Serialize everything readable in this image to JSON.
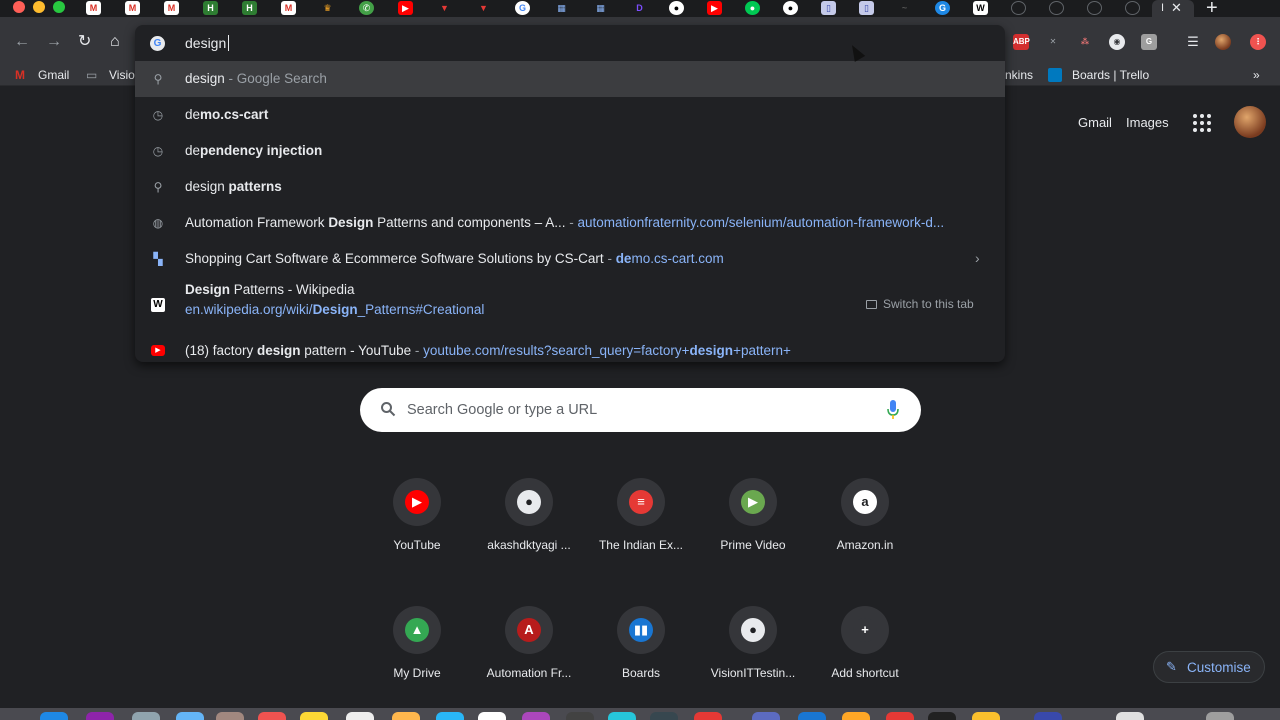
{
  "omnibox": {
    "query": "design",
    "suggestions": [
      {
        "icon": "search-icon",
        "plain_pre": "",
        "bold": "",
        "plain_post": "design",
        "url": "",
        "url_bold": "",
        "url_post": "",
        "extra": " - Google Search"
      },
      {
        "icon": "history-icon",
        "plain_pre": "de",
        "bold": "mo.cs-cart",
        "plain_post": "",
        "extra": ""
      },
      {
        "icon": "history-icon",
        "plain_pre": "de",
        "bold": "pendency injection",
        "plain_post": "",
        "extra": ""
      },
      {
        "icon": "search-icon",
        "plain_pre": "design ",
        "bold": "patterns",
        "plain_post": "",
        "extra": ""
      },
      {
        "icon": "globe-icon",
        "plain_pre": "Automation Framework ",
        "bold": "Design",
        "plain_post": " Patterns and components – A...",
        "url_sep": " - ",
        "url": "automationfraternity.com/selenium/automation-framework-d..."
      },
      {
        "icon": "cs-cart-icon",
        "plain_pre": "Shopping Cart Software & Ecommerce Software Solutions by CS-Cart",
        "bold": "",
        "plain_post": "",
        "url_sep": " - ",
        "url_bold": "de",
        "url": "mo.cs-cart.com"
      },
      {
        "icon": "wikipedia-icon",
        "line1_bold": "Design",
        "line1_rest": " Patterns - Wikipedia",
        "line2_pre": "en.wikipedia.org/wiki/",
        "line2_bold": "Design",
        "line2_post": "_Patterns#Creational",
        "action": "Switch to this tab"
      },
      {
        "icon": "youtube-icon",
        "plain_pre": "(18) factory ",
        "bold": "design",
        "plain_post": " pattern - YouTube",
        "url_sep": " - ",
        "url_pre": "youtube.com/results?search_query=factory+",
        "url_bold": "design",
        "url_post": "+pattern+"
      }
    ]
  },
  "bookmarks": {
    "gmail": "Gmail",
    "folder": "Visio",
    "jenkins": "nkins",
    "trello": "Boards | Trello",
    "more": "»"
  },
  "tabs": {
    "partial_title": "I",
    "close": "✕",
    "new_tab": "+"
  },
  "ntp": {
    "gmail_link": "Gmail",
    "images_link": "Images",
    "search_placeholder": "Search Google or type a URL",
    "shortcuts": [
      {
        "label": "YouTube",
        "glyph": "▶",
        "color": "#ff0000"
      },
      {
        "label": "akashdktyagi ...",
        "glyph": "●",
        "color": "#e8eaed"
      },
      {
        "label": "The Indian Ex...",
        "glyph": "≡",
        "color": "#e53935"
      },
      {
        "label": "Prime Video",
        "glyph": "▶",
        "color": "#6aa84f"
      },
      {
        "label": "Amazon.in",
        "glyph": "a",
        "color": "#ffffff"
      },
      {
        "label": "My Drive",
        "glyph": "▲",
        "color": "#34a853"
      },
      {
        "label": "Automation Fr...",
        "glyph": "A",
        "color": "#b71c1c"
      },
      {
        "label": "Boards",
        "glyph": "▮▮",
        "color": "#1976d2"
      },
      {
        "label": "VisionITTestin...",
        "glyph": "●",
        "color": "#e8eaed"
      },
      {
        "label": "Add shortcut",
        "glyph": "+",
        "color": "#35363a"
      }
    ],
    "customise": "Customise"
  },
  "colors": {
    "background": "#202124",
    "toolbar": "#35363a",
    "link_blue": "#8ab4f8",
    "selected_row": "#3c3d40"
  }
}
